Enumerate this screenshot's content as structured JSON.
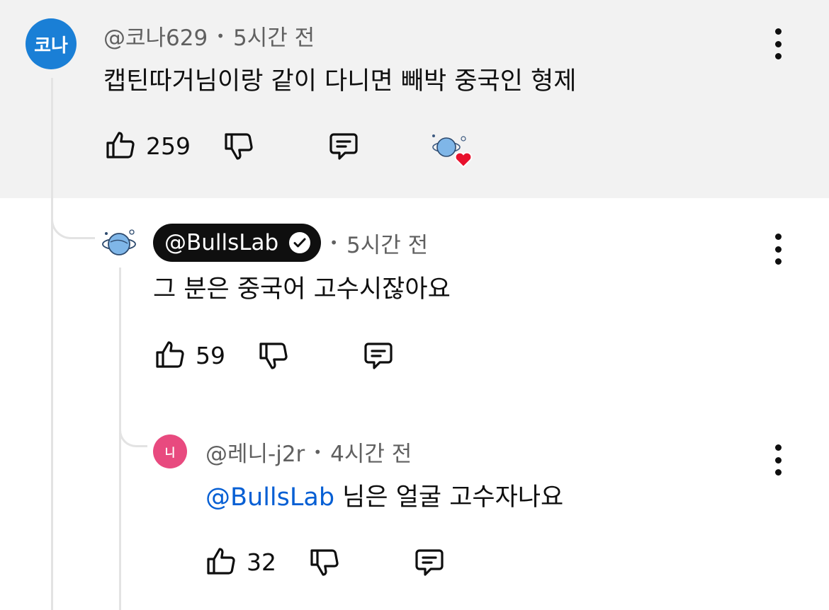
{
  "comments": [
    {
      "avatar_text": "코나",
      "author": "@코나629",
      "time": "5시간 전",
      "text": "캡틴따거님이랑 같이 다니면 빼박 중국인 형제",
      "likes": "259",
      "hearted_by_creator": true
    },
    {
      "author": "@BullsLab",
      "verified": true,
      "time": "5시간 전",
      "text": "그 분은 중국어 고수시잖아요",
      "likes": "59"
    },
    {
      "avatar_text": "니",
      "author": "@레니-j2r",
      "time": "4시간 전",
      "mention": "@BullsLab",
      "text": " 님은 얼굴 고수자나요",
      "likes": "32"
    }
  ],
  "separator": "•",
  "colors": {
    "highlight_bg": "#f2f2f2",
    "avatar1": "#1a7fd6",
    "avatar3": "#e84a7f",
    "mention": "#065fd4",
    "heart": "#e8112d"
  }
}
